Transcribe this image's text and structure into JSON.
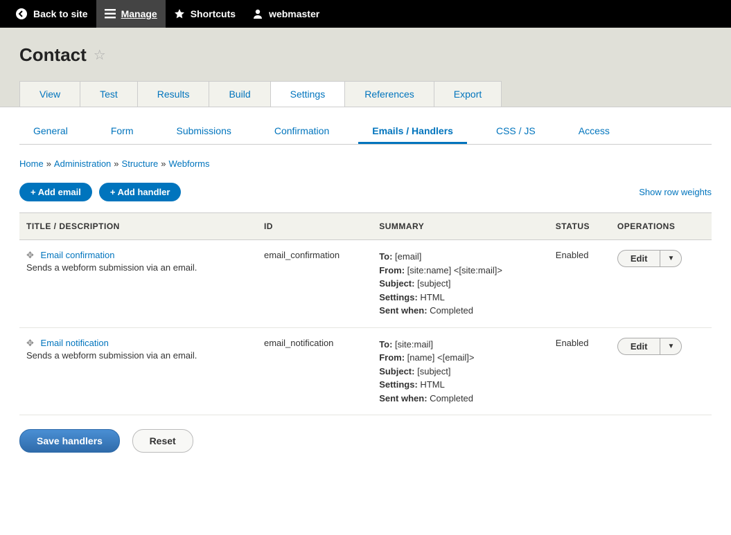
{
  "toolbar": {
    "back": "Back to site",
    "manage": "Manage",
    "shortcuts": "Shortcuts",
    "user": "webmaster"
  },
  "page": {
    "title": "Contact"
  },
  "primary_tabs": [
    {
      "label": "View",
      "active": false
    },
    {
      "label": "Test",
      "active": false
    },
    {
      "label": "Results",
      "active": false
    },
    {
      "label": "Build",
      "active": false
    },
    {
      "label": "Settings",
      "active": true
    },
    {
      "label": "References",
      "active": false
    },
    {
      "label": "Export",
      "active": false
    }
  ],
  "secondary_tabs": [
    {
      "label": "General",
      "active": false
    },
    {
      "label": "Form",
      "active": false
    },
    {
      "label": "Submissions",
      "active": false
    },
    {
      "label": "Confirmation",
      "active": false
    },
    {
      "label": "Emails / Handlers",
      "active": true
    },
    {
      "label": "CSS / JS",
      "active": false
    },
    {
      "label": "Access",
      "active": false
    }
  ],
  "breadcrumb": [
    {
      "label": "Home"
    },
    {
      "label": "Administration"
    },
    {
      "label": "Structure"
    },
    {
      "label": "Webforms"
    }
  ],
  "buttons": {
    "add_email": "+ Add email",
    "add_handler": "+ Add handler",
    "show_weights": "Show row weights",
    "save": "Save handlers",
    "reset": "Reset",
    "edit": "Edit"
  },
  "table": {
    "headers": {
      "title": "TITLE / DESCRIPTION",
      "id": "ID",
      "summary": "SUMMARY",
      "status": "STATUS",
      "operations": "OPERATIONS"
    },
    "rows": [
      {
        "title": "Email confirmation",
        "desc": "Sends a webform submission via an email.",
        "id": "email_confirmation",
        "summary": {
          "to_label": "To:",
          "to": "[email]",
          "from_label": "From:",
          "from": "[site:name] <[site:mail]>",
          "subject_label": "Subject:",
          "subject": "[subject]",
          "settings_label": "Settings:",
          "settings": "HTML",
          "sent_label": "Sent when:",
          "sent": "Completed"
        },
        "status": "Enabled"
      },
      {
        "title": "Email notification",
        "desc": "Sends a webform submission via an email.",
        "id": "email_notification",
        "summary": {
          "to_label": "To:",
          "to": "[site:mail]",
          "from_label": "From:",
          "from": "[name] <[email]>",
          "subject_label": "Subject:",
          "subject": "[subject]",
          "settings_label": "Settings:",
          "settings": "HTML",
          "sent_label": "Sent when:",
          "sent": "Completed"
        },
        "status": "Enabled"
      }
    ]
  }
}
